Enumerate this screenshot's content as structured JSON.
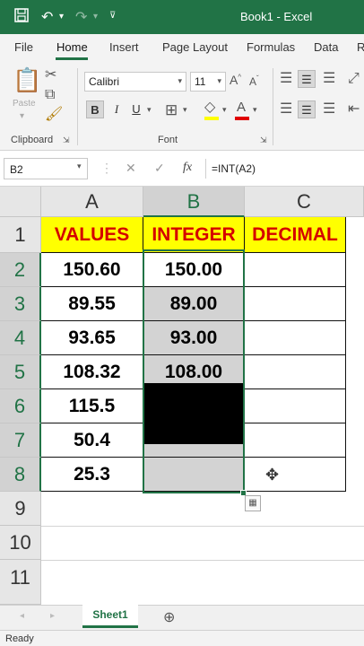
{
  "titlebar": {
    "title": "Book1  -  Excel",
    "save_icon": "save-icon",
    "undo_icon": "undo-icon",
    "redo_icon": "redo-icon",
    "customize_icon": "customize-qat-icon"
  },
  "ribbon_tabs": [
    "File",
    "Home",
    "Insert",
    "Page Layout",
    "Formulas",
    "Data",
    "R"
  ],
  "active_tab": "Home",
  "ribbon": {
    "clipboard": {
      "paste_label": "Paste",
      "group_label": "Clipboard"
    },
    "font": {
      "font_name": "Calibri",
      "font_size": "11",
      "group_label": "Font",
      "bold": "B",
      "italic": "I",
      "underline": "U"
    }
  },
  "formula_bar": {
    "name_box": "B2",
    "cancel_icon": "cancel-icon",
    "enter_icon": "check-icon",
    "fx_label": "fx",
    "formula": "=INT(A2)"
  },
  "columns": [
    "A",
    "B",
    "C"
  ],
  "selected_column": "B",
  "rows": [
    "1",
    "2",
    "3",
    "4",
    "5",
    "6",
    "7",
    "8",
    "9",
    "10",
    "11"
  ],
  "table": {
    "headers": [
      "VALUES",
      "INTEGER",
      "DECIMAL"
    ],
    "values": [
      "150.60",
      "89.55",
      "93.65",
      "108.32",
      "115.5",
      "50.4",
      "25.3"
    ],
    "integers": [
      "150.00",
      "89.00",
      "93.00",
      "108.00",
      "",
      "",
      ""
    ]
  },
  "header_fill": "#ffff00",
  "header_text_color": "#d40000",
  "accent": "#217346",
  "sheet_tab": "Sheet1",
  "status": "Ready"
}
